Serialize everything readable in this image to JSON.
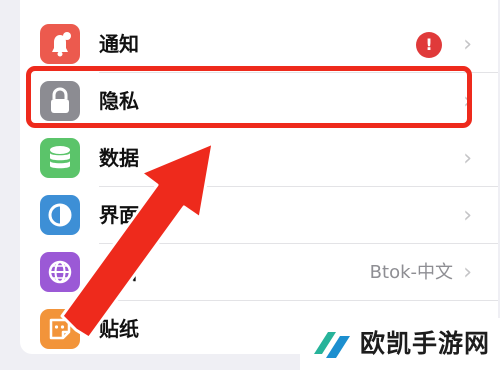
{
  "settings": {
    "rows": [
      {
        "label": "通知",
        "icon": "notification-bell-icon",
        "icon_color": "#ec5a4e",
        "badge": "!"
      },
      {
        "label": "隐私",
        "icon": "privacy-lock-icon",
        "icon_color": "#8c8c92"
      },
      {
        "label": "数据",
        "icon": "data-database-icon",
        "icon_color": "#5bc46a"
      },
      {
        "label": "界面",
        "icon": "interface-theme-icon",
        "icon_color": "#3d8fd6"
      },
      {
        "label": "语言",
        "icon": "language-globe-icon",
        "icon_color": "#9b59d6",
        "value": "Btok-中文"
      },
      {
        "label": "贴纸",
        "icon": "sticker-icon",
        "icon_color": "#f2943a"
      }
    ],
    "chevron": "›"
  },
  "annotation": {
    "highlight_color": "#ee2a1c"
  },
  "watermark": {
    "text": "欧凯手游网"
  }
}
